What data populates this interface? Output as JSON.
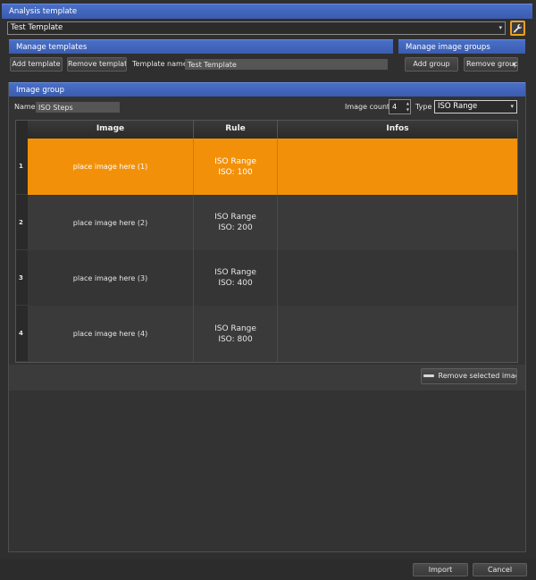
{
  "analysis_template": {
    "header": "Analysis template",
    "selected_template": "Test Template"
  },
  "manage_templates": {
    "header": "Manage templates",
    "add_label": "Add template",
    "remove_label": "Remove template",
    "name_label": "Template name",
    "name_value": "Test Template"
  },
  "manage_groups": {
    "header": "Manage image groups",
    "add_label": "Add group",
    "remove_label": "Remove group"
  },
  "image_group": {
    "header": "Image group",
    "name_label": "Name",
    "name_value": "ISO Steps",
    "count_label": "Image count",
    "count_value": "4",
    "type_label": "Type",
    "type_value": "ISO Range"
  },
  "table": {
    "columns": [
      "Image",
      "Rule",
      "Infos"
    ],
    "rows": [
      {
        "num": "1",
        "image": "place image here (1)",
        "rule": "ISO Range",
        "rule_detail": "ISO: 100",
        "info": "",
        "selected": true
      },
      {
        "num": "2",
        "image": "place image here (2)",
        "rule": "ISO Range",
        "rule_detail": "ISO: 200",
        "info": "",
        "selected": false
      },
      {
        "num": "3",
        "image": "place image here (3)",
        "rule": "ISO Range",
        "rule_detail": "ISO: 400",
        "info": "",
        "selected": false
      },
      {
        "num": "4",
        "image": "place image here (4)",
        "rule": "ISO Range",
        "rule_detail": "ISO: 800",
        "info": "",
        "selected": false
      }
    ]
  },
  "remove_selected_label": "Remove selected images",
  "footer": {
    "import_label": "Import",
    "cancel_label": "Cancel"
  },
  "colors": {
    "accent_blue": "#3a5cb0",
    "selection_orange": "#f29109",
    "background": "#2f2f2f"
  },
  "icons": {
    "settings": "wrench-icon",
    "dropdown": "chevron-down-icon",
    "remove": "minus-icon"
  }
}
